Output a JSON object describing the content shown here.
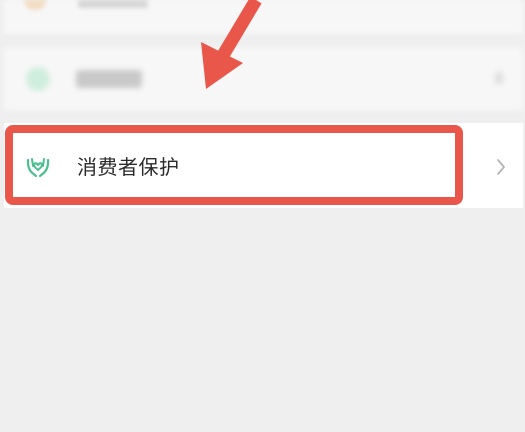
{
  "settings_list": {
    "items": [
      {
        "label": "",
        "icon": "blurred-icon"
      },
      {
        "label": "",
        "icon": "blurred-icon"
      },
      {
        "label": "消费者保护",
        "icon": "cupped-hands-icon",
        "chevron": "chevron-right-icon"
      }
    ]
  },
  "colors": {
    "background": "#efefef",
    "row_background": "#ffffff",
    "icon_green": "#4dbf8f",
    "highlight_red": "#e9574a",
    "text_primary": "#2b2b2b",
    "chevron_gray": "#b5b5b5"
  },
  "annotation": {
    "highlight": "red-rounded-rectangle",
    "pointer": "red-arrow"
  }
}
